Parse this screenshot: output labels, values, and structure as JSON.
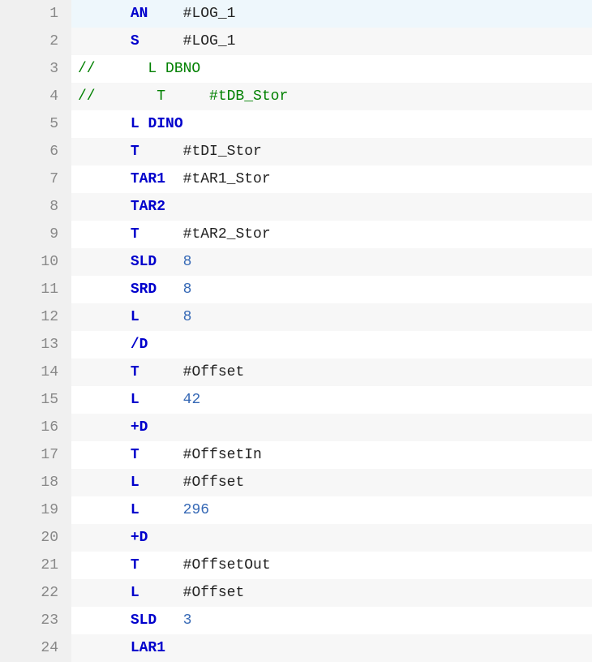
{
  "lines": [
    {
      "num": 1,
      "highlighted": true,
      "segments": [
        {
          "text": "      ",
          "type": "plain"
        },
        {
          "text": "AN",
          "type": "keyword"
        },
        {
          "text": "    ",
          "type": "plain"
        },
        {
          "text": "#LOG_1",
          "type": "identifier"
        }
      ]
    },
    {
      "num": 2,
      "segments": [
        {
          "text": "      ",
          "type": "plain"
        },
        {
          "text": "S",
          "type": "keyword"
        },
        {
          "text": "     ",
          "type": "plain"
        },
        {
          "text": "#LOG_1",
          "type": "identifier"
        }
      ]
    },
    {
      "num": 3,
      "segments": [
        {
          "text": "//      L DBNO",
          "type": "comment"
        }
      ]
    },
    {
      "num": 4,
      "segments": [
        {
          "text": "//       T     #tDB_Stor",
          "type": "comment"
        }
      ]
    },
    {
      "num": 5,
      "segments": [
        {
          "text": "      ",
          "type": "plain"
        },
        {
          "text": "L",
          "type": "keyword"
        },
        {
          "text": " ",
          "type": "plain"
        },
        {
          "text": "DINO",
          "type": "keyword"
        }
      ]
    },
    {
      "num": 6,
      "segments": [
        {
          "text": "      ",
          "type": "plain"
        },
        {
          "text": "T",
          "type": "keyword"
        },
        {
          "text": "     ",
          "type": "plain"
        },
        {
          "text": "#tDI_Stor",
          "type": "identifier"
        }
      ]
    },
    {
      "num": 7,
      "segments": [
        {
          "text": "      ",
          "type": "plain"
        },
        {
          "text": "TAR1",
          "type": "keyword"
        },
        {
          "text": "  ",
          "type": "plain"
        },
        {
          "text": "#tAR1_Stor",
          "type": "identifier"
        }
      ]
    },
    {
      "num": 8,
      "segments": [
        {
          "text": "      ",
          "type": "plain"
        },
        {
          "text": "TAR2",
          "type": "keyword"
        }
      ]
    },
    {
      "num": 9,
      "segments": [
        {
          "text": "      ",
          "type": "plain"
        },
        {
          "text": "T",
          "type": "keyword"
        },
        {
          "text": "     ",
          "type": "plain"
        },
        {
          "text": "#tAR2_Stor",
          "type": "identifier"
        }
      ]
    },
    {
      "num": 10,
      "segments": [
        {
          "text": "      ",
          "type": "plain"
        },
        {
          "text": "SLD",
          "type": "keyword"
        },
        {
          "text": "   ",
          "type": "plain"
        },
        {
          "text": "8",
          "type": "number"
        }
      ]
    },
    {
      "num": 11,
      "segments": [
        {
          "text": "      ",
          "type": "plain"
        },
        {
          "text": "SRD",
          "type": "keyword"
        },
        {
          "text": "   ",
          "type": "plain"
        },
        {
          "text": "8",
          "type": "number"
        }
      ]
    },
    {
      "num": 12,
      "segments": [
        {
          "text": "      ",
          "type": "plain"
        },
        {
          "text": "L",
          "type": "keyword"
        },
        {
          "text": "     ",
          "type": "plain"
        },
        {
          "text": "8",
          "type": "number"
        }
      ]
    },
    {
      "num": 13,
      "segments": [
        {
          "text": "      ",
          "type": "plain"
        },
        {
          "text": "/D",
          "type": "keyword"
        }
      ]
    },
    {
      "num": 14,
      "segments": [
        {
          "text": "      ",
          "type": "plain"
        },
        {
          "text": "T",
          "type": "keyword"
        },
        {
          "text": "     ",
          "type": "plain"
        },
        {
          "text": "#Offset",
          "type": "identifier"
        }
      ]
    },
    {
      "num": 15,
      "segments": [
        {
          "text": "      ",
          "type": "plain"
        },
        {
          "text": "L",
          "type": "keyword"
        },
        {
          "text": "     ",
          "type": "plain"
        },
        {
          "text": "42",
          "type": "number"
        }
      ]
    },
    {
      "num": 16,
      "segments": [
        {
          "text": "      ",
          "type": "plain"
        },
        {
          "text": "+D",
          "type": "keyword"
        }
      ]
    },
    {
      "num": 17,
      "segments": [
        {
          "text": "      ",
          "type": "plain"
        },
        {
          "text": "T",
          "type": "keyword"
        },
        {
          "text": "     ",
          "type": "plain"
        },
        {
          "text": "#OffsetIn",
          "type": "identifier"
        }
      ]
    },
    {
      "num": 18,
      "segments": [
        {
          "text": "      ",
          "type": "plain"
        },
        {
          "text": "L",
          "type": "keyword"
        },
        {
          "text": "     ",
          "type": "plain"
        },
        {
          "text": "#Offset",
          "type": "identifier"
        }
      ]
    },
    {
      "num": 19,
      "segments": [
        {
          "text": "      ",
          "type": "plain"
        },
        {
          "text": "L",
          "type": "keyword"
        },
        {
          "text": "     ",
          "type": "plain"
        },
        {
          "text": "296",
          "type": "number"
        }
      ]
    },
    {
      "num": 20,
      "segments": [
        {
          "text": "      ",
          "type": "plain"
        },
        {
          "text": "+D",
          "type": "keyword"
        }
      ]
    },
    {
      "num": 21,
      "segments": [
        {
          "text": "      ",
          "type": "plain"
        },
        {
          "text": "T",
          "type": "keyword"
        },
        {
          "text": "     ",
          "type": "plain"
        },
        {
          "text": "#OffsetOut",
          "type": "identifier"
        }
      ]
    },
    {
      "num": 22,
      "segments": [
        {
          "text": "      ",
          "type": "plain"
        },
        {
          "text": "L",
          "type": "keyword"
        },
        {
          "text": "     ",
          "type": "plain"
        },
        {
          "text": "#Offset",
          "type": "identifier"
        }
      ]
    },
    {
      "num": 23,
      "segments": [
        {
          "text": "      ",
          "type": "plain"
        },
        {
          "text": "SLD",
          "type": "keyword"
        },
        {
          "text": "   ",
          "type": "plain"
        },
        {
          "text": "3",
          "type": "number"
        }
      ]
    },
    {
      "num": 24,
      "segments": [
        {
          "text": "      ",
          "type": "plain"
        },
        {
          "text": "LAR1",
          "type": "keyword"
        }
      ]
    }
  ]
}
